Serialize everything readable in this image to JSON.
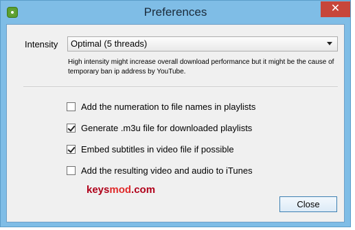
{
  "window": {
    "title": "Preferences",
    "close_glyph": "✕"
  },
  "intensity": {
    "label": "Intensity",
    "selected": "Optimal (5 threads)",
    "note": "High intensity might increase overall download performance but it might be the cause of temporary ban ip address by YouTube."
  },
  "options": [
    {
      "label": "Add the numeration to file names in playlists",
      "checked": false
    },
    {
      "label": "Generate .m3u file for downloaded playlists",
      "checked": true
    },
    {
      "label": "Embed subtitles in video file if possible",
      "checked": true
    },
    {
      "label": "Add the resulting video and audio to iTunes",
      "checked": false
    }
  ],
  "watermark": {
    "part1": "keys",
    "part2": "mod",
    "part3": ".com",
    "color_dark": "#b0001a",
    "color_light": "#e02a2a"
  },
  "buttons": {
    "close_label": "Close"
  },
  "colors": {
    "frame": "#7fbde6",
    "close_button": "#c7463a"
  }
}
